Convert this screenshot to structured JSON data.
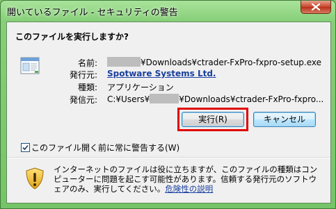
{
  "window": {
    "title": "開いているファイル - セキュリティの警告"
  },
  "dialog": {
    "heading": "このファイルを実行しますか?",
    "fields": {
      "name_label": "名前:",
      "name_value": "¥Downloads¥ctrader-FxPro-fxpro-setup.exe",
      "publisher_label": "発行元:",
      "publisher_value": "Spotware Systems Ltd.",
      "type_label": "種類:",
      "type_value": "アプリケーション",
      "from_label": "発信元:",
      "from_value_prefix": "C:¥Users¥",
      "from_value_suffix": "¥Downloads¥ctrader-FxPro-fxpro..."
    },
    "buttons": {
      "run": "実行(R)",
      "cancel": "キャンセル"
    },
    "checkbox": {
      "label": "このファイル開く前に常に警告する(W)",
      "checked": true
    },
    "warning": {
      "text": "インターネットのファイルは役に立ちますが、このファイルの種類はコンピューターに問題を起こす可能性があります。信頼する発行元のソフトウェアのみ、実行してください。",
      "link": "危険性の説明"
    }
  },
  "icons": {
    "close": "close-icon",
    "file": "application-file-icon",
    "checkmark": "checkmark-icon",
    "warning": "security-shield-warning-icon"
  },
  "colors": {
    "title_frame": "#86cf78",
    "highlight_border": "#e00000",
    "link": "#1a3f9e"
  }
}
